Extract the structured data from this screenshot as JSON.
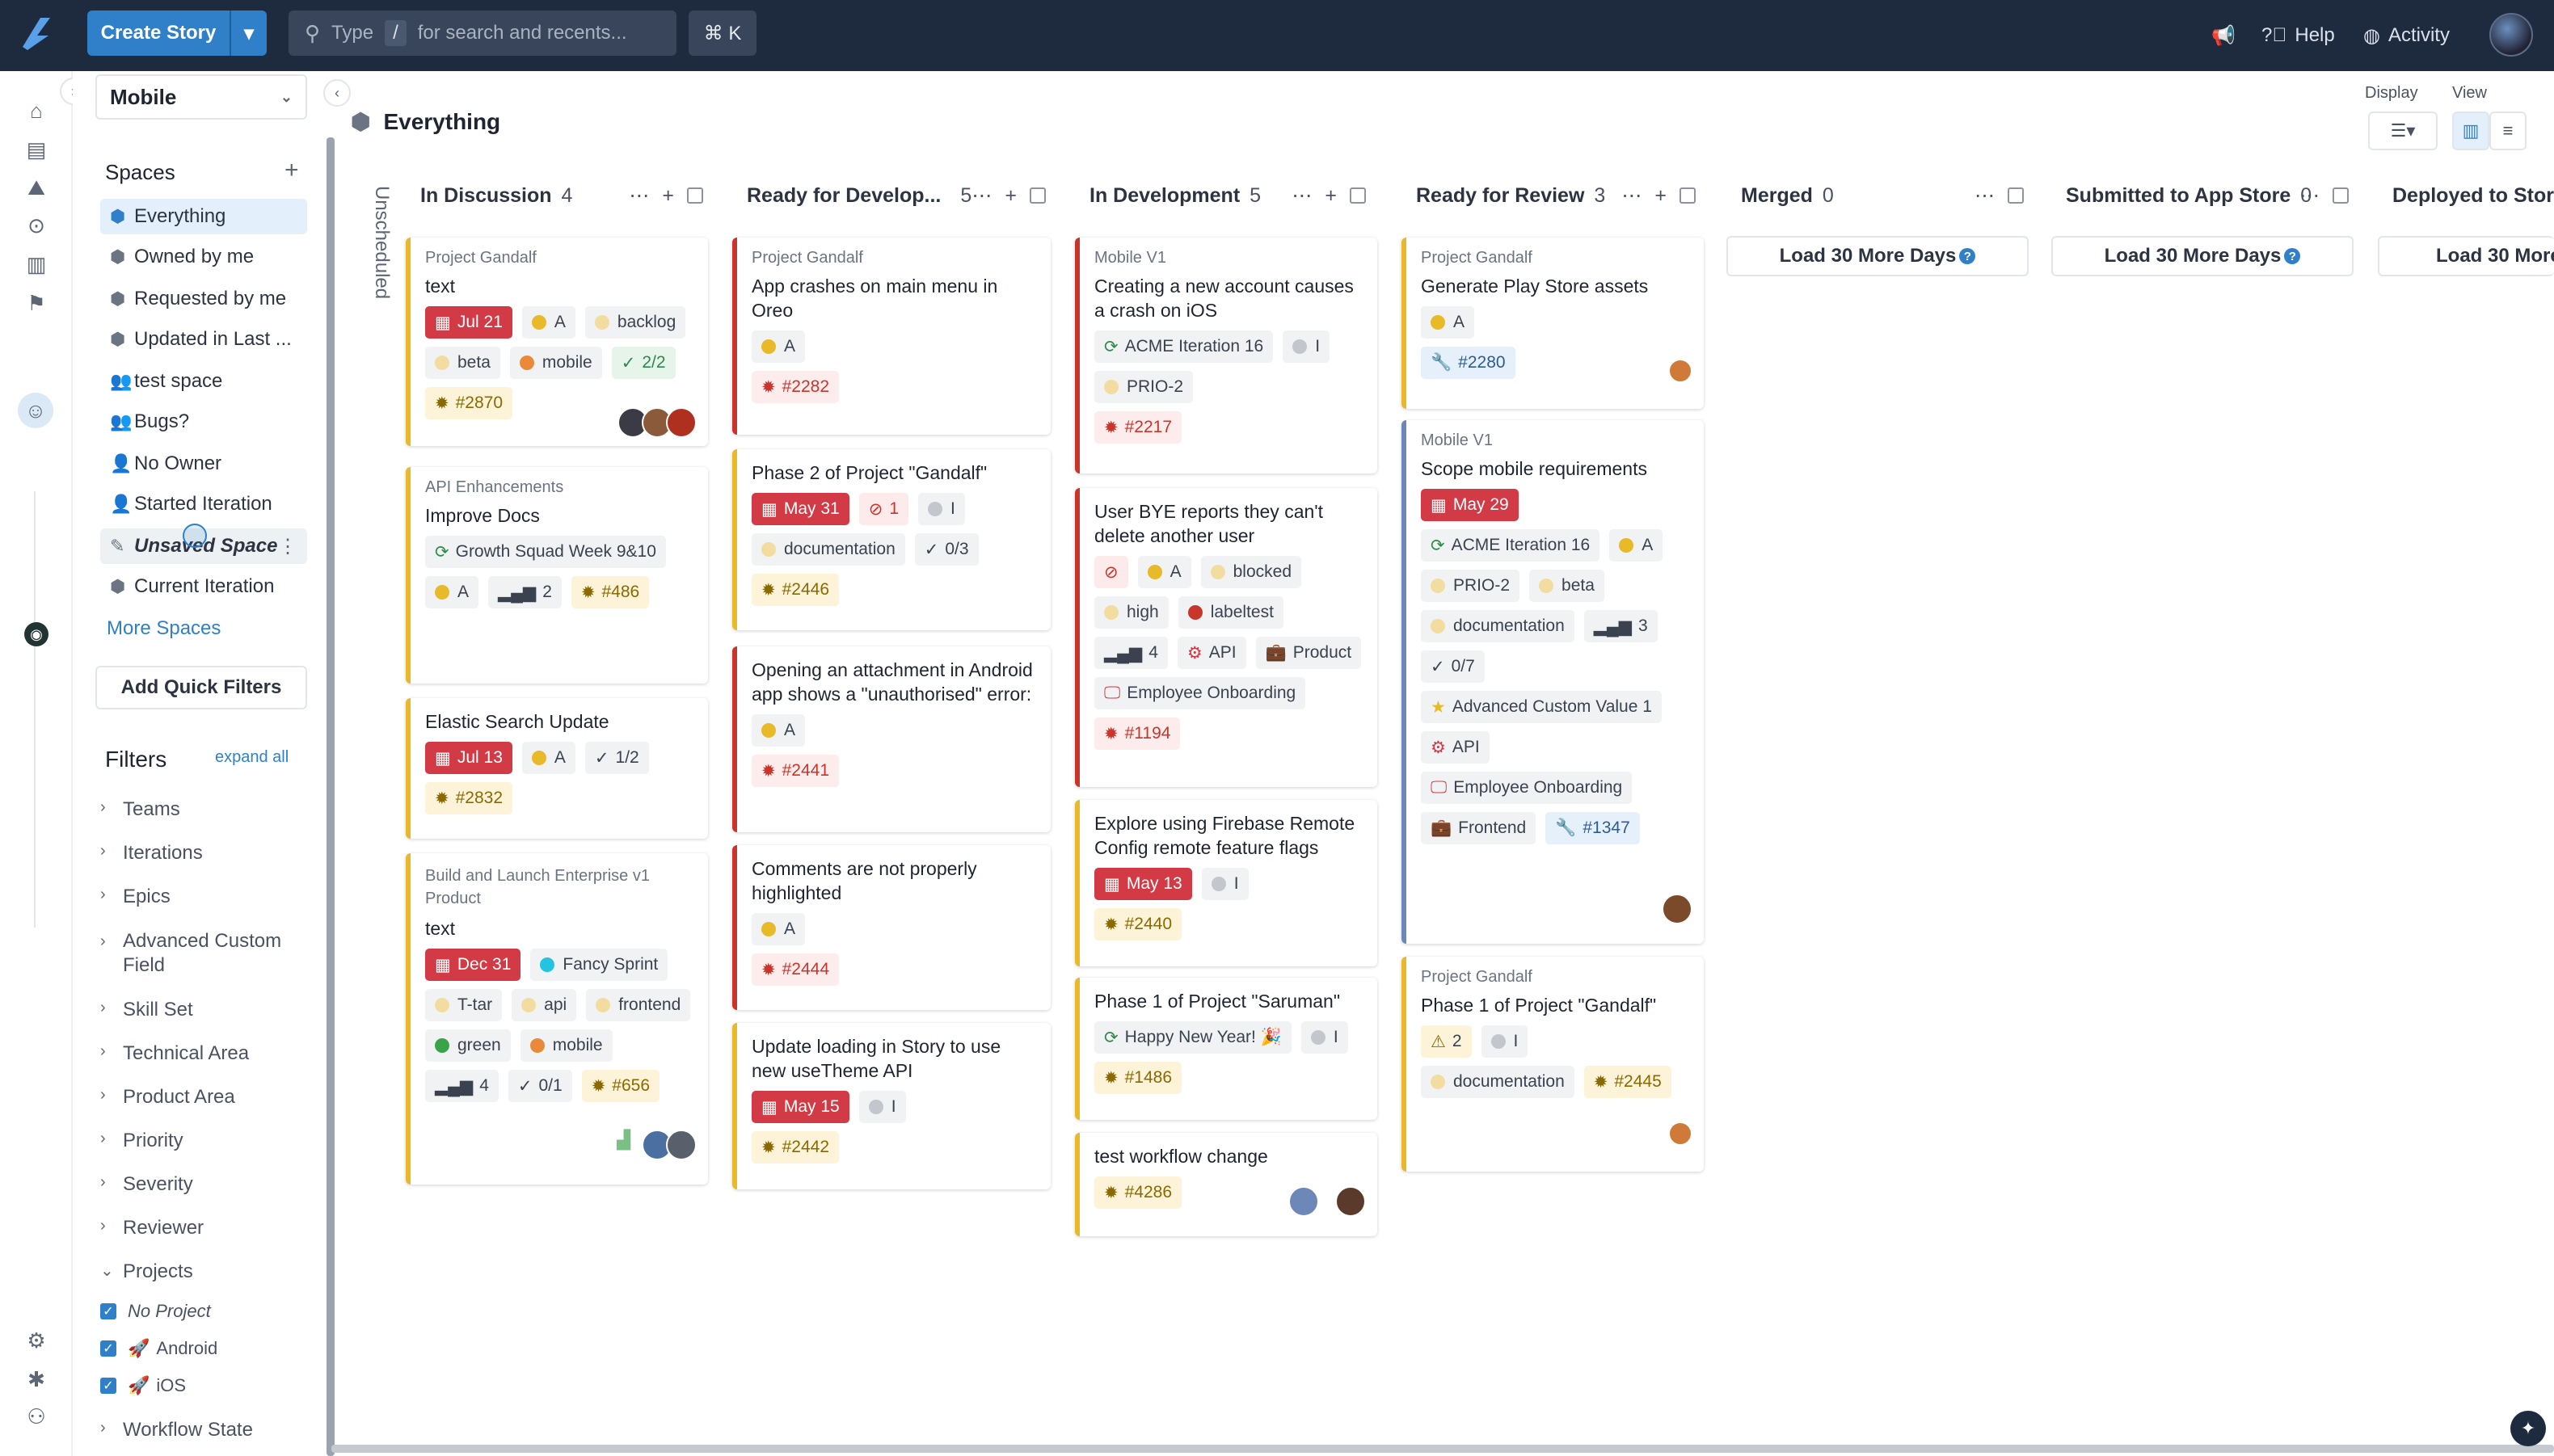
{
  "topbar": {
    "create_label": "Create Story",
    "search_prefix": "Type",
    "search_slash": "/",
    "search_suffix": "for search and recents...",
    "shortcut": "⌘ K",
    "help": "Help",
    "activity": "Activity"
  },
  "sidebar": {
    "workspace": "Mobile",
    "spaces_title": "Spaces",
    "spaces": [
      "Everything",
      "Owned by me",
      "Requested by me",
      "Updated in Last ...",
      "test space",
      "Bugs?",
      "No Owner",
      "Started Iteration",
      "Unsaved Space",
      "Current Iteration"
    ],
    "more_spaces": "More Spaces",
    "add_quick_filters": "Add Quick Filters",
    "filters_title": "Filters",
    "expand_all": "expand all",
    "filters": [
      "Teams",
      "Iterations",
      "Epics",
      "Advanced Custom Field",
      "Skill Set",
      "Technical Area",
      "Product Area",
      "Priority",
      "Severity",
      "Reviewer",
      "Projects"
    ],
    "projects": [
      "No Project",
      "Android",
      "iOS"
    ],
    "workflow_state": "Workflow State"
  },
  "main": {
    "title": "Everything",
    "unscheduled": "Unscheduled",
    "display_label": "Display",
    "view_label": "View",
    "load_more": "Load 30 More Days",
    "help_mark": "?"
  },
  "columns": [
    {
      "name": "In Discussion",
      "count": "4"
    },
    {
      "name": "Ready for Develop...",
      "count": "5"
    },
    {
      "name": "In Development",
      "count": "5"
    },
    {
      "name": "Ready for Review",
      "count": "3"
    },
    {
      "name": "Merged",
      "count": "0"
    },
    {
      "name": "Submitted to App Store",
      "count": "0"
    },
    {
      "name": "Deployed to Store",
      "count": ""
    }
  ],
  "cards": {
    "c1": {
      "proj": "Project Gandalf",
      "title": "text",
      "date": "Jul 21",
      "a": "A",
      "backlog": "backlog",
      "beta": "beta",
      "mobile": "mobile",
      "tasks": "2/2",
      "id": "#2870"
    },
    "c2": {
      "proj": "API Enhancements",
      "title": "Improve Docs",
      "iter": "Growth Squad Week 9&10",
      "a": "A",
      "est": "2",
      "id": "#486"
    },
    "c3": {
      "title": "Elastic Search Update",
      "date": "Jul 13",
      "a": "A",
      "tasks": "1/2",
      "id": "#2832"
    },
    "c4": {
      "proj": "Build and Launch Enterprise v1 Product",
      "title": "text",
      "date": "Dec 31",
      "iter": "Fancy Sprint",
      "l1": "T-tar",
      "l2": "api",
      "l3": "frontend",
      "l4": "green",
      "l5": "mobile",
      "est": "4",
      "tasks": "0/1",
      "id": "#656"
    },
    "d1": {
      "proj": "Project Gandalf",
      "title": "App crashes on main menu in Oreo",
      "a": "A",
      "id": "#2282"
    },
    "d2": {
      "title": "Phase 2 of Project \"Gandalf\"",
      "date": "May 31",
      "blk": "1",
      "i": "I",
      "doc": "documentation",
      "tasks": "0/3",
      "id": "#2446"
    },
    "d3": {
      "title": "Opening an attachment in Android app shows a \"unauthorised\" error:",
      "a": "A",
      "id": "#2441"
    },
    "d4": {
      "title": "Comments are not properly highlighted",
      "a": "A",
      "id": "#2444"
    },
    "d5": {
      "title": "Update loading in Story to use new useTheme API",
      "date": "May 15",
      "i": "I",
      "id": "#2442"
    },
    "e1": {
      "proj": "Mobile V1",
      "title": "Creating a new account causes a crash on iOS",
      "iter": "ACME Iteration 16",
      "i": "I",
      "prio": "PRIO-2",
      "id": "#2217"
    },
    "e2": {
      "title": "User BYE reports they can't delete another user",
      "a": "A",
      "blocked": "blocked",
      "high": "high",
      "labeltest": "labeltest",
      "est": "4",
      "api": "API",
      "product": "Product",
      "onb": "Employee Onboarding",
      "id": "#1194"
    },
    "e3": {
      "title": "Explore using Firebase Remote Config remote feature flags",
      "date": "May 13",
      "i": "I",
      "id": "#2440"
    },
    "e4": {
      "title": "Phase 1 of Project \"Saruman\"",
      "iter": "Happy New Year! 🎉",
      "i": "I",
      "id": "#1486"
    },
    "e5": {
      "title": "test workflow change",
      "id": "#4286"
    },
    "f1": {
      "proj": "Project Gandalf",
      "title": "Generate Play Store assets",
      "a": "A",
      "id": "#2280"
    },
    "f2": {
      "proj": "Mobile V1",
      "title": "Scope mobile requirements",
      "date": "May 29",
      "iter": "ACME Iteration 16",
      "a": "A",
      "prio": "PRIO-2",
      "beta": "beta",
      "doc": "documentation",
      "est": "3",
      "tasks": "0/7",
      "acv": "Advanced Custom Value 1",
      "api": "API",
      "onb": "Employee Onboarding",
      "fe": "Frontend",
      "id": "#1347"
    },
    "f3": {
      "proj": "Project Gandalf",
      "title": "Phase 1 of Project \"Gandalf\"",
      "warn": "2",
      "i": "I",
      "doc": "documentation",
      "id": "#2445"
    }
  }
}
